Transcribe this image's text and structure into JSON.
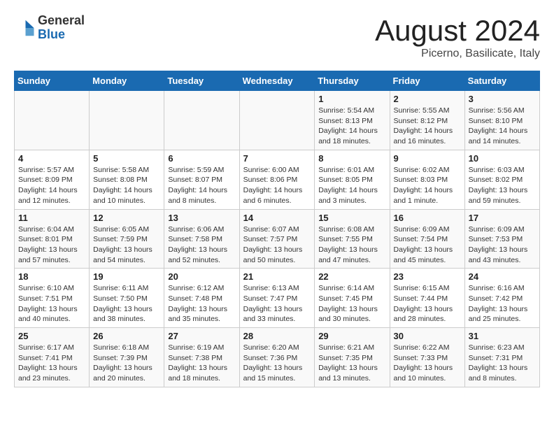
{
  "header": {
    "logo_general": "General",
    "logo_blue": "Blue",
    "month_year": "August 2024",
    "location": "Picerno, Basilicate, Italy"
  },
  "days_of_week": [
    "Sunday",
    "Monday",
    "Tuesday",
    "Wednesday",
    "Thursday",
    "Friday",
    "Saturday"
  ],
  "weeks": [
    [
      {
        "day": "",
        "info": ""
      },
      {
        "day": "",
        "info": ""
      },
      {
        "day": "",
        "info": ""
      },
      {
        "day": "",
        "info": ""
      },
      {
        "day": "1",
        "info": "Sunrise: 5:54 AM\nSunset: 8:13 PM\nDaylight: 14 hours\nand 18 minutes."
      },
      {
        "day": "2",
        "info": "Sunrise: 5:55 AM\nSunset: 8:12 PM\nDaylight: 14 hours\nand 16 minutes."
      },
      {
        "day": "3",
        "info": "Sunrise: 5:56 AM\nSunset: 8:10 PM\nDaylight: 14 hours\nand 14 minutes."
      }
    ],
    [
      {
        "day": "4",
        "info": "Sunrise: 5:57 AM\nSunset: 8:09 PM\nDaylight: 14 hours\nand 12 minutes."
      },
      {
        "day": "5",
        "info": "Sunrise: 5:58 AM\nSunset: 8:08 PM\nDaylight: 14 hours\nand 10 minutes."
      },
      {
        "day": "6",
        "info": "Sunrise: 5:59 AM\nSunset: 8:07 PM\nDaylight: 14 hours\nand 8 minutes."
      },
      {
        "day": "7",
        "info": "Sunrise: 6:00 AM\nSunset: 8:06 PM\nDaylight: 14 hours\nand 6 minutes."
      },
      {
        "day": "8",
        "info": "Sunrise: 6:01 AM\nSunset: 8:05 PM\nDaylight: 14 hours\nand 3 minutes."
      },
      {
        "day": "9",
        "info": "Sunrise: 6:02 AM\nSunset: 8:03 PM\nDaylight: 14 hours\nand 1 minute."
      },
      {
        "day": "10",
        "info": "Sunrise: 6:03 AM\nSunset: 8:02 PM\nDaylight: 13 hours\nand 59 minutes."
      }
    ],
    [
      {
        "day": "11",
        "info": "Sunrise: 6:04 AM\nSunset: 8:01 PM\nDaylight: 13 hours\nand 57 minutes."
      },
      {
        "day": "12",
        "info": "Sunrise: 6:05 AM\nSunset: 7:59 PM\nDaylight: 13 hours\nand 54 minutes."
      },
      {
        "day": "13",
        "info": "Sunrise: 6:06 AM\nSunset: 7:58 PM\nDaylight: 13 hours\nand 52 minutes."
      },
      {
        "day": "14",
        "info": "Sunrise: 6:07 AM\nSunset: 7:57 PM\nDaylight: 13 hours\nand 50 minutes."
      },
      {
        "day": "15",
        "info": "Sunrise: 6:08 AM\nSunset: 7:55 PM\nDaylight: 13 hours\nand 47 minutes."
      },
      {
        "day": "16",
        "info": "Sunrise: 6:09 AM\nSunset: 7:54 PM\nDaylight: 13 hours\nand 45 minutes."
      },
      {
        "day": "17",
        "info": "Sunrise: 6:09 AM\nSunset: 7:53 PM\nDaylight: 13 hours\nand 43 minutes."
      }
    ],
    [
      {
        "day": "18",
        "info": "Sunrise: 6:10 AM\nSunset: 7:51 PM\nDaylight: 13 hours\nand 40 minutes."
      },
      {
        "day": "19",
        "info": "Sunrise: 6:11 AM\nSunset: 7:50 PM\nDaylight: 13 hours\nand 38 minutes."
      },
      {
        "day": "20",
        "info": "Sunrise: 6:12 AM\nSunset: 7:48 PM\nDaylight: 13 hours\nand 35 minutes."
      },
      {
        "day": "21",
        "info": "Sunrise: 6:13 AM\nSunset: 7:47 PM\nDaylight: 13 hours\nand 33 minutes."
      },
      {
        "day": "22",
        "info": "Sunrise: 6:14 AM\nSunset: 7:45 PM\nDaylight: 13 hours\nand 30 minutes."
      },
      {
        "day": "23",
        "info": "Sunrise: 6:15 AM\nSunset: 7:44 PM\nDaylight: 13 hours\nand 28 minutes."
      },
      {
        "day": "24",
        "info": "Sunrise: 6:16 AM\nSunset: 7:42 PM\nDaylight: 13 hours\nand 25 minutes."
      }
    ],
    [
      {
        "day": "25",
        "info": "Sunrise: 6:17 AM\nSunset: 7:41 PM\nDaylight: 13 hours\nand 23 minutes."
      },
      {
        "day": "26",
        "info": "Sunrise: 6:18 AM\nSunset: 7:39 PM\nDaylight: 13 hours\nand 20 minutes."
      },
      {
        "day": "27",
        "info": "Sunrise: 6:19 AM\nSunset: 7:38 PM\nDaylight: 13 hours\nand 18 minutes."
      },
      {
        "day": "28",
        "info": "Sunrise: 6:20 AM\nSunset: 7:36 PM\nDaylight: 13 hours\nand 15 minutes."
      },
      {
        "day": "29",
        "info": "Sunrise: 6:21 AM\nSunset: 7:35 PM\nDaylight: 13 hours\nand 13 minutes."
      },
      {
        "day": "30",
        "info": "Sunrise: 6:22 AM\nSunset: 7:33 PM\nDaylight: 13 hours\nand 10 minutes."
      },
      {
        "day": "31",
        "info": "Sunrise: 6:23 AM\nSunset: 7:31 PM\nDaylight: 13 hours\nand 8 minutes."
      }
    ]
  ]
}
